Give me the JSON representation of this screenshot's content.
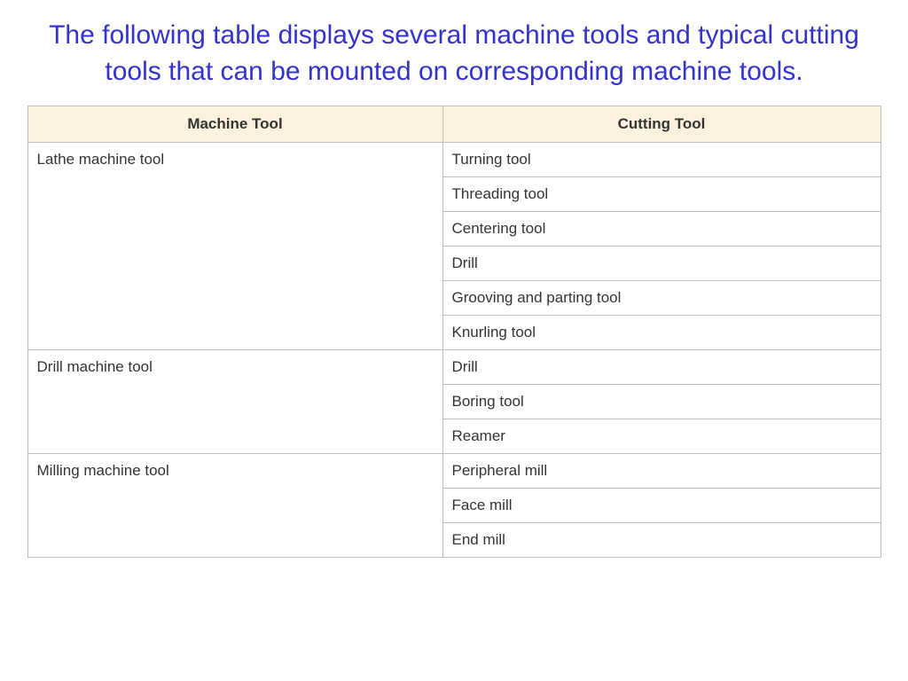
{
  "title": "The following table displays several machine tools and typical cutting tools that can be mounted on corresponding machine tools.",
  "table": {
    "headers": {
      "machine": "Machine Tool",
      "cutting": "Cutting Tool"
    },
    "groups": [
      {
        "machine": "Lathe machine tool",
        "cutting": [
          "Turning tool",
          "Threading tool",
          "Centering tool",
          "Drill",
          "Grooving and parting tool",
          "Knurling tool"
        ]
      },
      {
        "machine": "Drill machine tool",
        "cutting": [
          "Drill",
          "Boring tool",
          "Reamer"
        ]
      },
      {
        "machine": "Milling machine tool",
        "cutting": [
          "Peripheral mill",
          "Face mill",
          "End mill"
        ]
      }
    ]
  }
}
